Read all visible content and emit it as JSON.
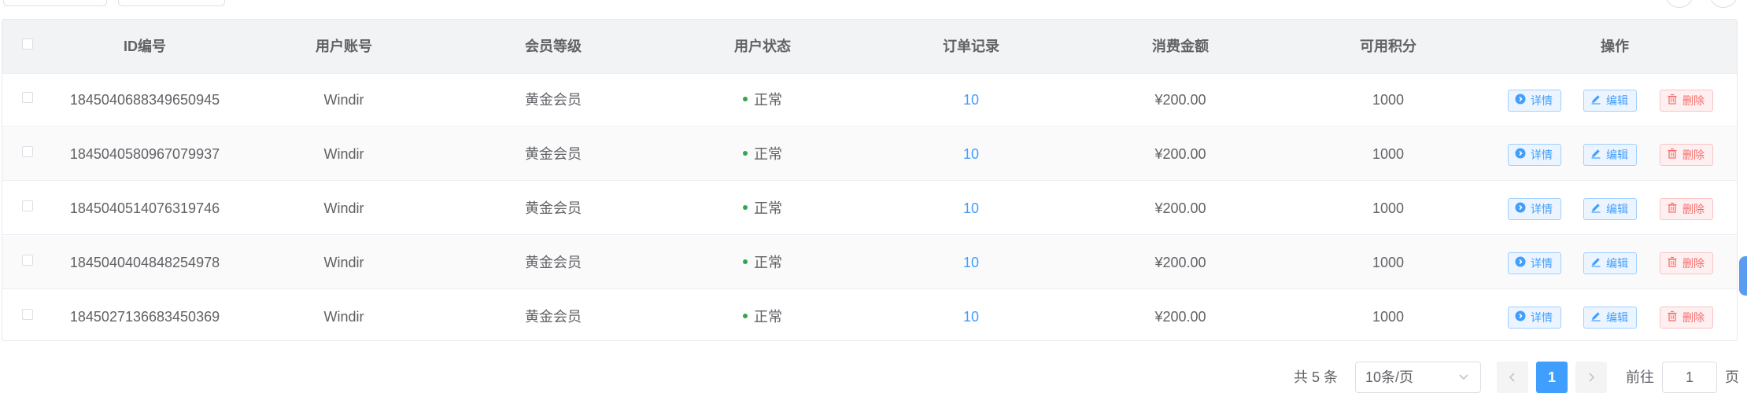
{
  "table": {
    "headers": {
      "id": "ID编号",
      "account": "用户账号",
      "level": "会员等级",
      "status": "用户状态",
      "orders": "订单记录",
      "amount": "消费金额",
      "points": "可用积分",
      "actions": "操作"
    },
    "rows": [
      {
        "id": "1845040688349650945",
        "account": "Windir",
        "level": "黄金会员",
        "status": "正常",
        "orders": "10",
        "amount": "¥200.00",
        "points": "1000"
      },
      {
        "id": "1845040580967079937",
        "account": "Windir",
        "level": "黄金会员",
        "status": "正常",
        "orders": "10",
        "amount": "¥200.00",
        "points": "1000"
      },
      {
        "id": "1845040514076319746",
        "account": "Windir",
        "level": "黄金会员",
        "status": "正常",
        "orders": "10",
        "amount": "¥200.00",
        "points": "1000"
      },
      {
        "id": "1845040404848254978",
        "account": "Windir",
        "level": "黄金会员",
        "status": "正常",
        "orders": "10",
        "amount": "¥200.00",
        "points": "1000"
      },
      {
        "id": "1845027136683450369",
        "account": "Windir",
        "level": "黄金会员",
        "status": "正常",
        "orders": "10",
        "amount": "¥200.00",
        "points": "1000"
      }
    ],
    "actions": {
      "detail": "详情",
      "edit": "编辑",
      "delete": "删除"
    }
  },
  "pagination": {
    "total_text": "共 5 条",
    "page_size": "10条/页",
    "current_page": "1",
    "goto_prefix": "前往",
    "goto_value": "1",
    "goto_suffix": "页"
  },
  "colors": {
    "primary": "#409eff",
    "danger": "#f56c6c",
    "status_ok": "#2fa84f"
  }
}
